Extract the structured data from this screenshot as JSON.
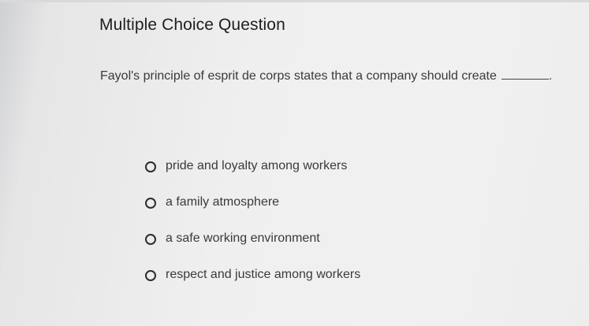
{
  "question": {
    "heading": "Multiple Choice Question",
    "prompt": "Fayol's principle of esprit de corps states that a company should create",
    "blank_end": "."
  },
  "options": [
    {
      "label": "pride and loyalty among workers",
      "selected": false
    },
    {
      "label": "a family atmosphere",
      "selected": false
    },
    {
      "label": "a safe working environment",
      "selected": false
    },
    {
      "label": "respect and justice among workers",
      "selected": false
    }
  ]
}
